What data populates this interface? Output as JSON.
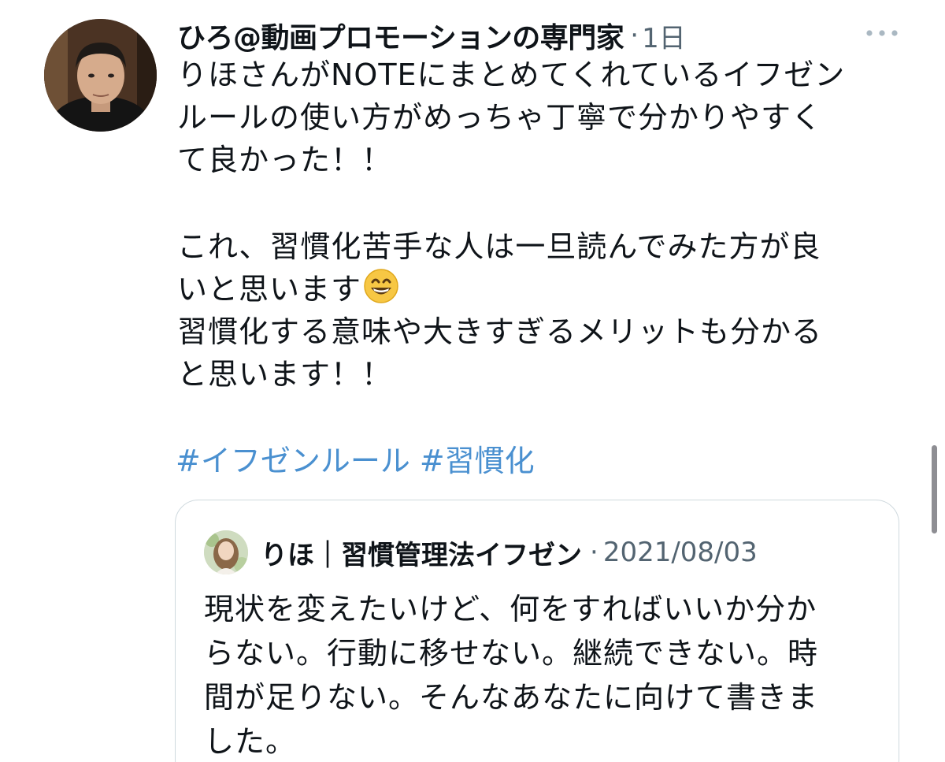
{
  "tweet": {
    "author_name": "ひろ@動画プロモーションの専門家",
    "separator": "·",
    "timestamp": "1日",
    "body_lines": [
      "りほさんがNOTEにまとめてくれているイフゼン",
      "ルールの使い方がめっちゃ丁寧で分かりやすく",
      "て良かった！！",
      "",
      "これ、習慣化苦手な人は一旦読んでみた方が良",
      "いと思います",
      "習慣化する意味や大きすぎるメリットも分かる",
      "と思います！！"
    ],
    "emoji": "grinning-face-with-smiling-eyes",
    "hashtags": [
      "#イフゼンルール",
      "#習慣化"
    ],
    "more_icon": "more-horizontal-icon"
  },
  "quoted_tweet": {
    "author_name": "りほ｜習慣管理法イフゼン",
    "separator": "·",
    "date": "2021/08/03",
    "text_lines": [
      "現状を変えたいけど、何をすればいいか分か",
      "らない。行動に移せない。継続できない。時",
      "間が足りない。そんなあなたに向けて書きま",
      "した。"
    ]
  },
  "colors": {
    "text": "#0f1419",
    "secondary": "#536471",
    "hashtag": "#4a90d0",
    "border": "#cfd9de",
    "scrollbar": "#8e8e93"
  }
}
